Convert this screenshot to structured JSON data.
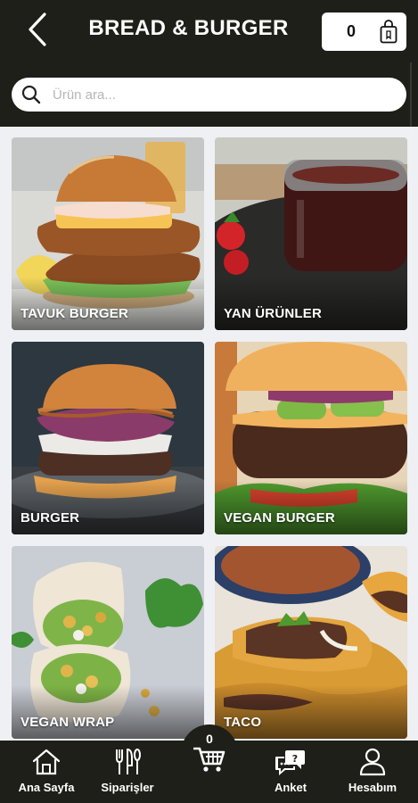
{
  "header": {
    "title": "BREAD & BURGER",
    "cart_count": "0",
    "back_icon": "chevron-left-icon",
    "bag_icon": "shopping-bag-icon"
  },
  "search": {
    "placeholder": "Ürün ara..."
  },
  "categories": [
    {
      "label": "TAVUK BURGER"
    },
    {
      "label": "YAN ÜRÜNLER"
    },
    {
      "label": "BURGER"
    },
    {
      "label": "VEGAN BURGER"
    },
    {
      "label": "VEGAN WRAP"
    },
    {
      "label": "TACO"
    }
  ],
  "bottom_nav": {
    "items": [
      {
        "label": "Ana Sayfa",
        "icon": "home-icon"
      },
      {
        "label": "Siparişler",
        "icon": "cutlery-icon"
      },
      {
        "label": "Anket",
        "icon": "survey-chat-icon"
      },
      {
        "label": "Hesabım",
        "icon": "user-icon"
      }
    ],
    "cart_count": "0",
    "cart_icon": "shopping-cart-icon"
  },
  "colors": {
    "header_bg": "#1d1f18",
    "page_bg": "#eef0f3"
  }
}
